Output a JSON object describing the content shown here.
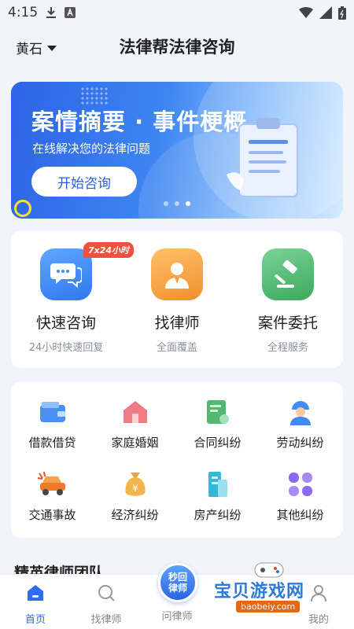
{
  "status_bar": {
    "time": "4:15"
  },
  "header": {
    "city": "黄石",
    "title": "法律帮法律咨询"
  },
  "banner": {
    "title": "案情摘要 · 事件梗概",
    "subtitle": "在线解决您的法律问题",
    "button_label": "开始咨询",
    "pages": 3,
    "active_page": 3
  },
  "features": [
    {
      "label": "快速咨询",
      "sub": "24小时快速回复",
      "badge": "7x24小时",
      "icon": "chat-bubbles-icon",
      "color": "#3f8cf7"
    },
    {
      "label": "找律师",
      "sub": "全面覆盖",
      "icon": "lawyer-icon",
      "color": "#f4a040"
    },
    {
      "label": "案件委托",
      "sub": "全程服务",
      "icon": "gavel-icon",
      "color": "#48b865"
    }
  ],
  "categories": [
    {
      "label": "借款借贷",
      "icon": "wallet-icon"
    },
    {
      "label": "家庭婚姻",
      "icon": "house-icon"
    },
    {
      "label": "合同纠纷",
      "icon": "contract-icon"
    },
    {
      "label": "劳动纠纷",
      "icon": "worker-icon"
    },
    {
      "label": "交通事故",
      "icon": "car-crash-icon"
    },
    {
      "label": "经济纠纷",
      "icon": "money-bag-icon"
    },
    {
      "label": "房产纠纷",
      "icon": "building-icon"
    },
    {
      "label": "其他纠纷",
      "icon": "grid-icon"
    }
  ],
  "section": {
    "title": "精英律师团队"
  },
  "bottom_nav": {
    "items": [
      {
        "label": "首页",
        "icon": "home-icon",
        "active": true
      },
      {
        "label": "找律师",
        "icon": "search-icon",
        "active": false
      },
      {
        "label": "问律师",
        "icon": "ask-icon",
        "active": false
      },
      {
        "label": "我的",
        "icon": "profile-icon",
        "active": false
      }
    ],
    "center_button": {
      "line1": "秒回",
      "line2": "律师"
    }
  },
  "watermark": {
    "text": "宝贝游戏网",
    "url": "baobeiy.com"
  },
  "colors": {
    "accent": "#2f6df0",
    "badge": "#f0513d"
  }
}
